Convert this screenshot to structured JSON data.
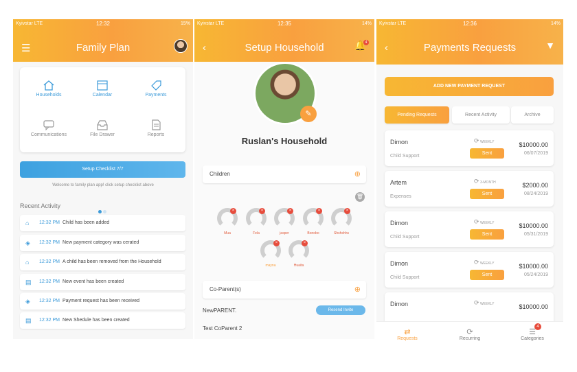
{
  "status": {
    "carrier": "Kyivstar LTE",
    "time1": "12:32",
    "time2": "12:35",
    "time3": "12:36",
    "battery1": "15%",
    "battery2": "14%",
    "battery3": "14%"
  },
  "family": {
    "title": "Family Plan",
    "grid": [
      {
        "label": "Households",
        "icon": "house-icon"
      },
      {
        "label": "Calendar",
        "icon": "calendar-icon"
      },
      {
        "label": "Payments",
        "icon": "tag-icon"
      },
      {
        "label": "Communications",
        "icon": "chat-icon"
      },
      {
        "label": "File Drawer",
        "icon": "tray-icon"
      },
      {
        "label": "Reports",
        "icon": "document-icon"
      }
    ],
    "checklist": "Setup Checklist 7/7",
    "welcome": "Welcome to family plan app! click setup checklist above",
    "recent_title": "Recent Activity",
    "activity": [
      {
        "time": "12:32 PM",
        "text": "Child has been added"
      },
      {
        "time": "12:32 PM",
        "text": "New payment category was cerated"
      },
      {
        "time": "12:32 PM",
        "text": "A child has been removed from the Household"
      },
      {
        "time": "12:32 PM",
        "text": "New event has been created"
      },
      {
        "time": "12:32 PM",
        "text": "Payment request has been received"
      },
      {
        "time": "12:32 PM",
        "text": "New Shedule has been created"
      }
    ]
  },
  "household": {
    "title": "Setup Household",
    "bell_count": "4",
    "name": "Ruslan's Household",
    "children_label": "Children",
    "children": [
      "Mua",
      "Fela",
      "jasper",
      "Bonobo",
      "Shshshhs",
      "mayna",
      "Huaita"
    ],
    "coparents_label": "Co-Parent(s)",
    "coparent1": "NewPARENT.",
    "resend": "Resend Invite",
    "coparent2": "Test CoParent 2"
  },
  "payments": {
    "title": "Payments Requests",
    "add_button": "ADD NEW PAYMENT REQUEST",
    "segments": [
      "Pending Requests",
      "Recent Activity",
      "Archive"
    ],
    "rows": [
      {
        "name": "Dimon",
        "category": "Child Support",
        "freq": "WEEKLY",
        "status": "Sent",
        "amount": "$10000.00",
        "date": "06/07/2019"
      },
      {
        "name": "Artem",
        "category": "Expenses",
        "freq": "3-MONTH",
        "status": "Sent",
        "amount": "$2000.00",
        "date": "08/24/2019"
      },
      {
        "name": "Dimon",
        "category": "Child Support",
        "freq": "WEEKLY",
        "status": "Sent",
        "amount": "$10000.00",
        "date": "05/31/2019"
      },
      {
        "name": "Dimon",
        "category": "Child Support",
        "freq": "WEEKLY",
        "status": "Sent",
        "amount": "$10000.00",
        "date": "05/24/2019"
      },
      {
        "name": "Dimon",
        "category": "",
        "freq": "WEEKLY",
        "status": "",
        "amount": "$10000.00",
        "date": ""
      }
    ],
    "tabs": [
      "Requests",
      "Recurring",
      "Categories"
    ],
    "categories_badge": "4"
  }
}
